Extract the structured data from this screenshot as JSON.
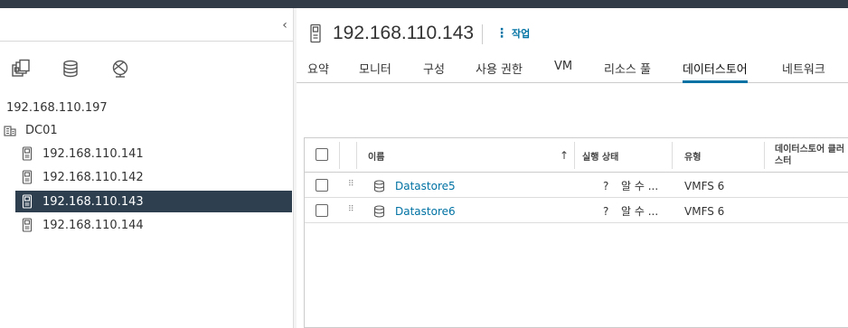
{
  "sidebar": {
    "collapse_glyph": "‹",
    "nav_icons": [
      "hosts-clusters-icon",
      "storage-icon",
      "network-icon"
    ],
    "tree": [
      {
        "label": "192.168.110.197",
        "icon": "vcenter"
      },
      {
        "label": "DC01",
        "icon": "datacenter-icon"
      },
      {
        "label": "192.168.110.141",
        "icon": "host-icon"
      },
      {
        "label": "192.168.110.142",
        "icon": "host-icon"
      },
      {
        "label": "192.168.110.143",
        "icon": "host-icon",
        "selected": true
      },
      {
        "label": "192.168.110.144",
        "icon": "host-icon"
      }
    ]
  },
  "header": {
    "title": "192.168.110.143",
    "actions_label": "작업",
    "actions_glyph": "⋮"
  },
  "tabs": [
    {
      "label": "요약"
    },
    {
      "label": "모니터"
    },
    {
      "label": "구성"
    },
    {
      "label": "사용 권한"
    },
    {
      "label": "VM"
    },
    {
      "label": "리소스 풀"
    },
    {
      "label": "데이터스토어",
      "active": true
    },
    {
      "label": "네트워크"
    }
  ],
  "grid": {
    "columns": {
      "name": "이름",
      "sort_glyph": "↑",
      "status": "실행 상태",
      "type": "유형",
      "cluster": "데이터스토어 클러스터"
    },
    "rows": [
      {
        "name": "Datastore5",
        "status_glyph": "?",
        "status": "알 수 ...",
        "type": "VMFS 6",
        "cluster": ""
      },
      {
        "name": "Datastore6",
        "status_glyph": "?",
        "status": "알 수 ...",
        "type": "VMFS 6",
        "cluster": ""
      }
    ],
    "drag_glyph": "⠿"
  },
  "colors": {
    "topbar": "#313c48",
    "selected_row": "#2e3f4f",
    "link": "#0072a3"
  }
}
